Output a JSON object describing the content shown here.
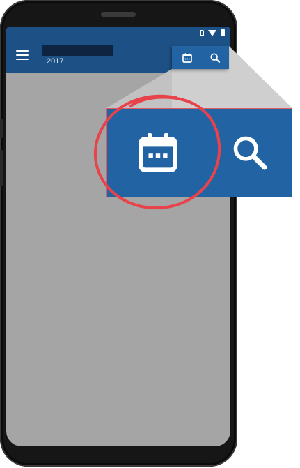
{
  "appbar": {
    "subtitle": "2017",
    "primary_color": "#1d5185",
    "menu_icon": "hamburger-menu-icon"
  },
  "statusbar": {
    "icons": [
      "vibrate-icon",
      "wifi-icon",
      "battery-icon"
    ]
  },
  "actions": {
    "calendar_icon": "calendar-icon",
    "search_icon": "search-icon",
    "accent_color": "#2264a3"
  },
  "callout": {
    "highlight_color": "#e8434b",
    "shadow_color": "#d0d0d0"
  }
}
